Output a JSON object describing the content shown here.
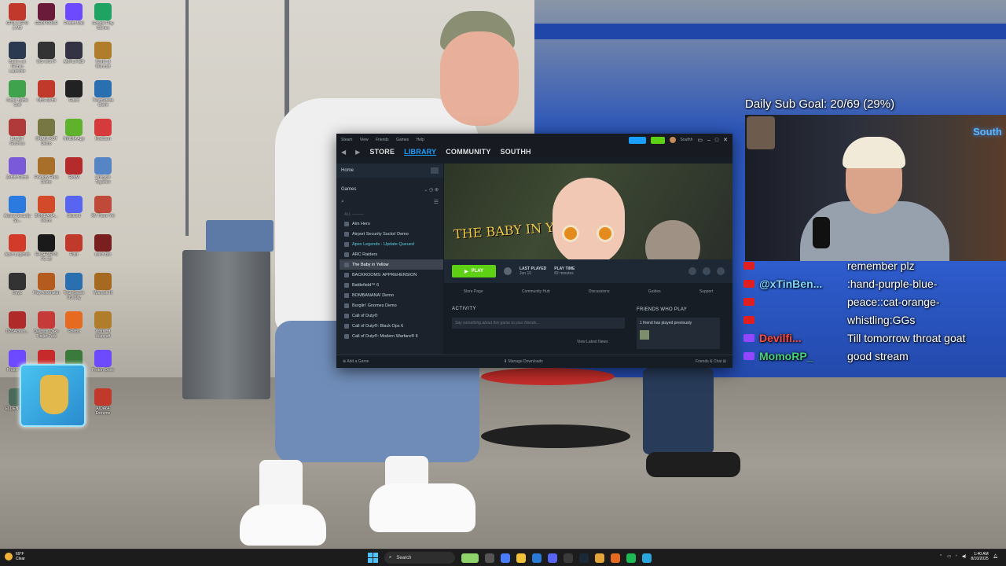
{
  "desktop": {
    "icons": [
      {
        "label": "GPU-Z GPU Z.MD",
        "color": "#c0392b"
      },
      {
        "label": "GEOFORCE",
        "color": "#6a1b3a"
      },
      {
        "label": "Proton Mail",
        "color": "#6d4aff"
      },
      {
        "label": "Google Play Games",
        "color": "#1ea362"
      },
      {
        "label": "Battle.net Games Launcher",
        "color": "#2b3a50"
      },
      {
        "label": "WG WGTF",
        "color": "#333"
      },
      {
        "label": "AMPLIFIED",
        "color": "#334"
      },
      {
        "label": "World of Warcraft",
        "color": "#b07d2a"
      },
      {
        "label": "Super Battle Golf",
        "color": "#3fa34d"
      },
      {
        "label": "OBS 32 bit",
        "color": "#c0392b"
      },
      {
        "label": "Gasol",
        "color": "#222"
      },
      {
        "label": "TeamSpeak Client",
        "color": "#2a6fb0"
      },
      {
        "label": "Burglin' Gnomes",
        "color": "#b03a3a"
      },
      {
        "label": "GRAIN ROT Demo",
        "color": "#774"
      },
      {
        "label": "NVIDIA App",
        "color": "#5fb32c"
      },
      {
        "label": "RobCam",
        "color": "#d63b3b"
      },
      {
        "label": "Zenith Climb",
        "color": "#7a5ad8"
      },
      {
        "label": "Friendly Fires Demo",
        "color": "#a86f2a"
      },
      {
        "label": "RedM",
        "color": "#b52b2b"
      },
      {
        "label": "Unicycle Together",
        "color": "#5585c5"
      },
      {
        "label": "Airport Security Su...",
        "color": "#2b7ae0"
      },
      {
        "label": "BOMBANA... Demo",
        "color": "#d24a2a"
      },
      {
        "label": "Discord",
        "color": "#5865f2"
      },
      {
        "label": "RV There Yet",
        "color": "#c04a3a"
      },
      {
        "label": "Apex Legends",
        "color": "#d23a2a"
      },
      {
        "label": "EA SPORTS FC 25",
        "color": "#1a1a1a"
      },
      {
        "label": "Rust",
        "color": "#c0392b"
      },
      {
        "label": "Liar's Bar",
        "color": "#7a1f1f"
      },
      {
        "label": "DayZ",
        "color": "#333"
      },
      {
        "label": "Play Ascension",
        "color": "#b45b1f"
      },
      {
        "label": "TeamSpeak Overlay",
        "color": "#2a6fb0"
      },
      {
        "label": "Warcraft III",
        "color": "#a56a1f"
      },
      {
        "label": "DZSALaun...",
        "color": "#b02a2a"
      },
      {
        "label": "Davison Oaks Trailer Park",
        "color": "#c63a3a"
      },
      {
        "label": "Firefox",
        "color": "#e66a1f"
      },
      {
        "label": "World of Warcraft",
        "color": "#b07d2a"
      },
      {
        "label": "Proton VPN",
        "color": "#6d4aff"
      },
      {
        "label": "The Baby in Yellow",
        "color": "#c62a2a"
      },
      {
        "label": "Command & Conquer",
        "color": "#3a7a3a"
      },
      {
        "label": "Proton Drive",
        "color": "#6d4aff"
      },
      {
        "label": "ELDEN RING",
        "color": "#4a6a5a"
      },
      {
        "label": "Apex Legends",
        "color": "#d23a2a"
      },
      {
        "label": "Proton Pass",
        "color": "#8a4aff"
      },
      {
        "label": "AIDA64 Extreme",
        "color": "#c0392b"
      }
    ]
  },
  "steam": {
    "menu": [
      "Steam",
      "View",
      "Friends",
      "Games",
      "Help"
    ],
    "username": "Southh",
    "nav": {
      "store": "STORE",
      "library": "LIBRARY",
      "community": "COMMUNITY",
      "user": "SOUTHH"
    },
    "sidebar": {
      "home": "Home",
      "games_label": "Games",
      "section": "ALL",
      "games": [
        {
          "name": "Aim Hero",
          "state": "normal"
        },
        {
          "name": "Airport Security Sucks! Demo",
          "state": "normal"
        },
        {
          "name": "Apex Legends - Update Queued",
          "state": "update"
        },
        {
          "name": "ARC Raiders",
          "state": "normal"
        },
        {
          "name": "The Baby in Yellow",
          "state": "active"
        },
        {
          "name": "BACKROOMS: APPREHENSION",
          "state": "normal"
        },
        {
          "name": "Battlefield™ 6",
          "state": "normal"
        },
        {
          "name": "BOMBANANA! Demo",
          "state": "normal"
        },
        {
          "name": "Burglin' Gnomes Demo",
          "state": "normal"
        },
        {
          "name": "Call of Duty®",
          "state": "normal"
        },
        {
          "name": "Call of Duty®: Black Ops 6",
          "state": "normal"
        },
        {
          "name": "Call of Duty®: Modern Warfare® II",
          "state": "normal"
        }
      ]
    },
    "hero_title": "THE BABY IN YELLOW",
    "play_label": "PLAY",
    "last_played": {
      "label": "LAST PLAYED",
      "value": "Jun 10"
    },
    "play_time": {
      "label": "PLAY TIME",
      "value": "82 minutes"
    },
    "subnav": [
      "Store Page",
      "Community Hub",
      "Discussions",
      "Guides",
      "Support"
    ],
    "activity": {
      "heading": "ACTIVITY",
      "placeholder": "Say something about this game to your friends...",
      "news": "View Latest News"
    },
    "friends": {
      "heading": "FRIENDS WHO PLAY",
      "text": "1 friend has played previously"
    },
    "footer": {
      "add_game": "Add a Game",
      "downloads": "Manage Downloads",
      "friends_chat": "Friends & Chat"
    }
  },
  "overlay": {
    "sub_goal": "Daily Sub Goal: 20/69 (29%)",
    "cam_sign": "South",
    "chat": [
      {
        "platform": "youtube",
        "user": "",
        "user_color": "#ffffff",
        "message": "remember plz",
        "icon_color": "#e02020"
      },
      {
        "platform": "youtube",
        "user": "@xTinBen...",
        "user_color": "#7fd6ff",
        "message": ":hand-purple-blue-",
        "icon_color": "#e02020"
      },
      {
        "platform": "youtube",
        "user": "",
        "user_color": "#ffffff",
        "message": "peace::cat-orange-",
        "icon_color": "#e02020"
      },
      {
        "platform": "youtube",
        "user": "",
        "user_color": "#ffffff",
        "message": "whistling:GGs",
        "icon_color": "#e02020"
      },
      {
        "platform": "twitch",
        "user": "Devilfi...",
        "user_color": "#ff4a3a",
        "message": "Till tomorrow throat goat",
        "icon_color": "#9146ff"
      },
      {
        "platform": "twitch",
        "user": "MomoRP_",
        "user_color": "#4ad07a",
        "message": "good stream",
        "icon_color": "#9146ff"
      }
    ]
  },
  "taskbar": {
    "weather_temp": "69°F",
    "weather_desc": "Clear",
    "search_label": "Search",
    "time": "1:40 AM",
    "date": "8/10/2025"
  }
}
